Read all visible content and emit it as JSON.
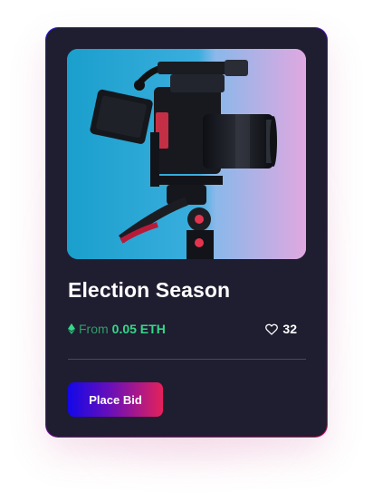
{
  "card": {
    "title": "Election Season",
    "image_alt_icon": "camera-on-tripod-photo",
    "price": {
      "currency_icon": "ethereum-icon",
      "prefix": "From",
      "amount": "0.05 ETH"
    },
    "likes": {
      "icon": "heart-icon",
      "count": "32"
    },
    "bid_button_label": "Place Bid"
  },
  "colors": {
    "card_background": "#1f1d30",
    "accent_blue": "#1308e8",
    "accent_pink": "#e4215c",
    "price_green": "#34d889"
  }
}
